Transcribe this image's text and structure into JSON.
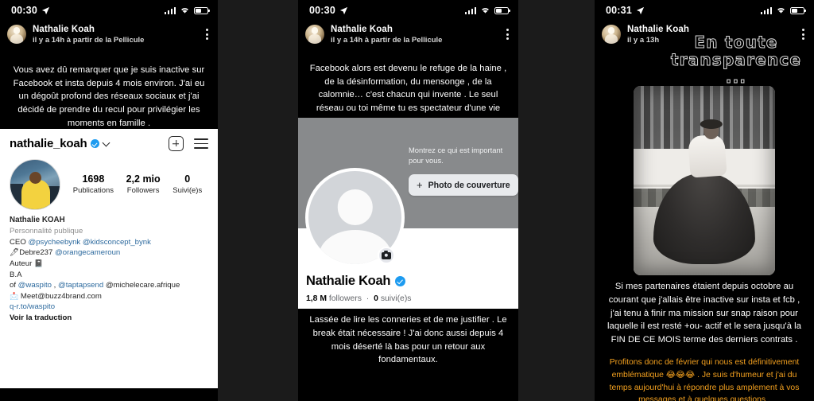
{
  "meta": {
    "description": "Three stacked mobile screenshots of Snapchat-style story posts by Nathalie Koah"
  },
  "panels": [
    {
      "id": "panel-1",
      "status_bar": {
        "time": "00:30",
        "location_icon": "location-arrow-icon",
        "signal_icon": "signal-bars-icon",
        "wifi_icon": "wifi-icon",
        "battery_icon": "battery-icon"
      },
      "post_header": {
        "avatar": "user-avatar",
        "name": "Nathalie Koah",
        "subtitle": "il y a 14h à partir de la Pellicule",
        "menu_icon": "kebab-menu-icon"
      },
      "caption": "Vous avez dû remarquer que je suis inactive sur Facebook et insta depuis 4 mois environ. J'ai eu un dégoût profond des réseaux sociaux et j'ai décidé de prendre du recul pour privilégier les moments en famille .",
      "instagram": {
        "username": "nathalie_koah",
        "verified_icon": "verified-badge-icon",
        "chevron_icon": "chevron-down-icon",
        "add_icon": "plus-box-icon",
        "menu_icon": "hamburger-menu-icon",
        "avatar": "profile-picture",
        "stats": [
          {
            "value": "1698",
            "label": "Publications"
          },
          {
            "value": "2,2 mio",
            "label": "Followers"
          },
          {
            "value": "0",
            "label": "Suivi(e)s"
          }
        ],
        "bio": {
          "name": "Nathalie KOAH",
          "category": "Personnalité publique",
          "line_ceo_prefix": "CEO ",
          "line_ceo_m1": "@psycheebynk",
          "line_ceo_m2": "@kidsconcept_bynk",
          "pen_emoji": "🖊",
          "line_debre": "Debre237 ",
          "line_debre_m": "@orangecameroun",
          "line_auteur": "Auteur ",
          "book_emoji": "📓",
          "line_ba": "B.A",
          "line_of_prefix": "of ",
          "line_of_m1": "@waspito",
          "line_of_sep": " , ",
          "line_of_m2": "@taptapsend",
          "line_of_m3": " @michelecare.afrique",
          "mail_emoji": "📩",
          "line_mail": " Meet@buzz4brand.com",
          "link": "q-r.to/waspito",
          "translate": "Voir la traduction"
        }
      }
    },
    {
      "id": "panel-2",
      "status_bar": {
        "time": "00:30"
      },
      "post_header": {
        "name": "Nathalie Koah",
        "subtitle": "il y a 14h à partir de la Pellicule"
      },
      "caption": "Facebook alors est devenu le refuge de la haine , de la désinformation, du mensonge , de la calomnie… c'est chacun qui invente . Le seul réseau ou toi même tu es spectateur d'une vie qu'on te façonne.",
      "facebook": {
        "cover_prompt": "Montrez ce qui est important pour vous.",
        "cover_button": "Photo de couverture",
        "cover_button_icon": "plus-icon",
        "profile_photo_icon": "default-avatar-icon",
        "camera_badge_icon": "camera-icon",
        "name": "Nathalie Koah",
        "verified_icon": "verified-badge-icon",
        "followers_value": "1,8 M",
        "followers_label": "followers",
        "separator": "·",
        "following_value": "0",
        "following_label": "suivi(e)s"
      },
      "bottom_caption": "Lassée de lire les conneries et de me justifier . Le break était nécessaire ! J'ai donc aussi depuis 4 mois déserté là bas pour un retour aux fondamentaux."
    },
    {
      "id": "panel-3",
      "status_bar": {
        "time": "00:31"
      },
      "post_header": {
        "name": "Nathalie Koah",
        "subtitle": "il y a 13h"
      },
      "sticker_title_line1": "En toute",
      "sticker_title_line2": "transparence ...",
      "photo_alt": "black-and-white-photo-woman-long-skirt",
      "body_text": "Si mes partenaires étaient depuis octobre au courant que j'allais être inactive sur insta et fcb , j'ai tenu à finir ma mission sur snap raison pour laquelle il est resté +ou- actif et le sera jusqu'à la FIN DE CE MOIS terme des derniers contrats .",
      "orange_text": "Profitons donc de février qui nous est définitivement emblématique 😂😂😂 . Je suis d'humeur et j'ai du temps aujourd'hui à répondre plus amplement à vos messages et à quelques questions ."
    }
  ],
  "colors": {
    "background": "#1b1b1b",
    "panel_background": "#000000",
    "instagram_card": "#ffffff",
    "verified_blue": "#1d9bf0",
    "facebook_cover": "#888a8c",
    "orange_text": "#f4a11f",
    "mention_blue": "#2d6a9e"
  }
}
